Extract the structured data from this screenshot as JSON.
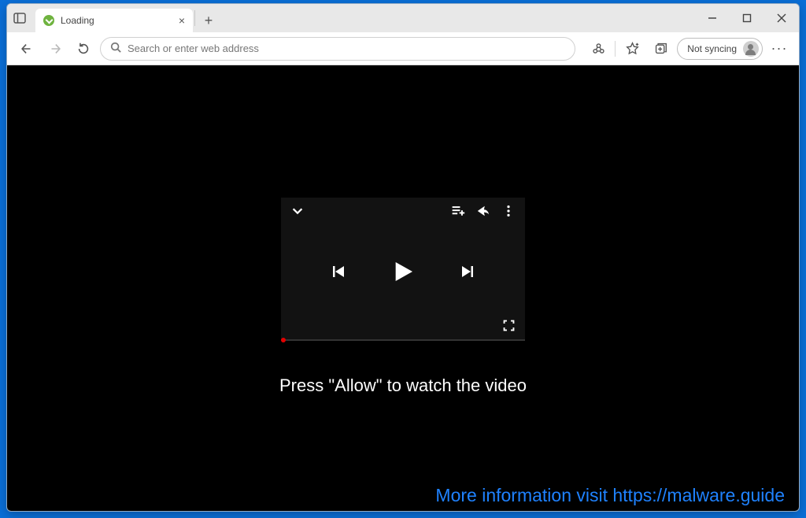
{
  "tab": {
    "title": "Loading"
  },
  "address_bar": {
    "placeholder": "Search or enter web address"
  },
  "profile": {
    "label": "Not syncing"
  },
  "page": {
    "message": "Press \"Allow\" to watch the video",
    "footer_link": "More information visit https://malware.guide"
  }
}
